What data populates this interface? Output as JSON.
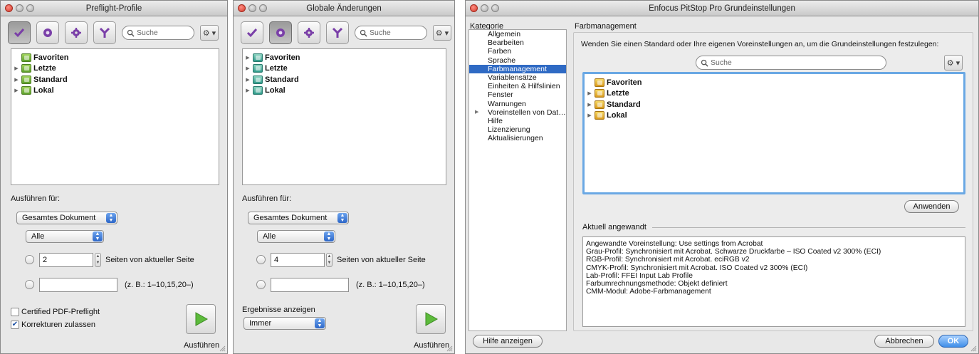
{
  "win1": {
    "title": "Preflight-Profile",
    "search_placeholder": "Suche",
    "gear": "⚙ ▾",
    "tree": [
      "Favoriten",
      "Letzte",
      "Standard",
      "Lokal"
    ],
    "run_for_label": "Ausführen für:",
    "scope": "Gesamtes Dokument",
    "filter": "Alle",
    "pages_value": "2",
    "pages_label": "Seiten von aktueller Seite",
    "range_hint": "(z. B.: 1–10,15,20–)",
    "certified_label": "Certified PDF-Preflight",
    "corrections_label": "Korrekturen zulassen",
    "run_label": "Ausführen"
  },
  "win2": {
    "title": "Globale Änderungen",
    "search_placeholder": "Suche",
    "gear": "⚙ ▾",
    "tree": [
      "Favoriten",
      "Letzte",
      "Standard",
      "Lokal"
    ],
    "run_for_label": "Ausführen für:",
    "scope": "Gesamtes Dokument",
    "filter": "Alle",
    "pages_value": "4",
    "pages_label": "Seiten von aktueller Seite",
    "range_hint": "(z. B.: 1–10,15,20–)",
    "results_label": "Ergebnisse anzeigen",
    "results_value": "Immer",
    "run_label": "Ausführen"
  },
  "win3": {
    "title": "Enfocus PitStop Pro Grundeinstellungen",
    "category_header": "Kategorie",
    "categories": [
      "Allgemein",
      "Bearbeiten",
      "Farben",
      "Sprache",
      "Farbmanagement",
      "Variablensätze",
      "Einheiten & Hilfslinien",
      "Fenster",
      "Warnungen",
      "Voreinstellen von Dat…",
      "Hilfe",
      "Lizenzierung",
      "Aktualisierungen"
    ],
    "selected_category": "Farbmanagement",
    "section_title": "Farbmanagement",
    "instruction": "Wenden Sie einen Standard oder Ihre eigenen Voreinstellungen an, um die Grundeinstellungen festzulegen:",
    "search_placeholder": "Suche",
    "gear": "⚙ ▾",
    "tree": [
      "Favoriten",
      "Letzte",
      "Standard",
      "Lokal"
    ],
    "apply_label": "Anwenden",
    "applied_title": "Aktuell angewandt",
    "applied_lines": [
      "Angewandte Voreinstellung: Use settings from Acrobat",
      "Grau-Profil: Synchronisiert mit Acrobat. Schwarze Druckfarbe – ISO Coated v2 300% (ECI)",
      "RGB-Profil: Synchronisiert mit Acrobat. eciRGB v2",
      "CMYK-Profil: Synchronisiert mit Acrobat. ISO Coated v2 300% (ECI)",
      "Lab-Profil: FFEI Input Lab Profile",
      "Farbumrechnungsmethode: Objekt definiert",
      "CMM-Modul: Adobe-Farbmanagement"
    ],
    "help_label": "Hilfe anzeigen",
    "cancel_label": "Abbrechen",
    "ok_label": "OK"
  }
}
